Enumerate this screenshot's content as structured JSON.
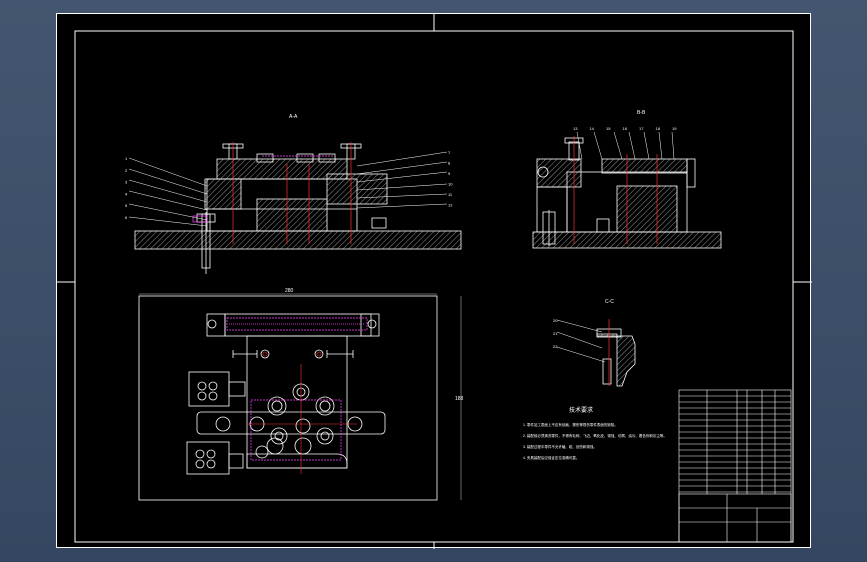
{
  "drawing": {
    "colors": {
      "background": "#000000",
      "line": "#ffffff",
      "hatch": "#cfcfcf",
      "accent": "#ff44ff",
      "red": "#ff3030",
      "screen": "#3f5169"
    },
    "view_labels": {
      "section_a": "A-A",
      "section_b": "B-B",
      "section_c": "C-C"
    },
    "dims": {
      "plan_width": "280",
      "plan_height": "188"
    },
    "part_numbers_left": [
      "1",
      "2",
      "3",
      "4",
      "5",
      "6"
    ],
    "part_numbers_right": [
      "7",
      "8",
      "9",
      "10",
      "11",
      "12"
    ],
    "part_numbers_b_top": [
      "13",
      "14",
      "15",
      "16",
      "17",
      "18",
      "19"
    ],
    "part_numbers_c": [
      "20",
      "21",
      "22"
    ],
    "tech_title": "技术要求",
    "tech_lines": [
      "1. 零件加工表面上不应有划痕、擦伤等损伤零件表面的缺陷。",
      "2. 装配前必须清洗零件，不得有毛刺、飞边、氧化皮、锈蚀、切屑、油污、着色剂和灰尘等。",
      "3. 装配过程中零件不允许磕、碰、划伤和锈蚀。",
      "4. 夹具装配后应保证定位准确可靠。"
    ]
  }
}
